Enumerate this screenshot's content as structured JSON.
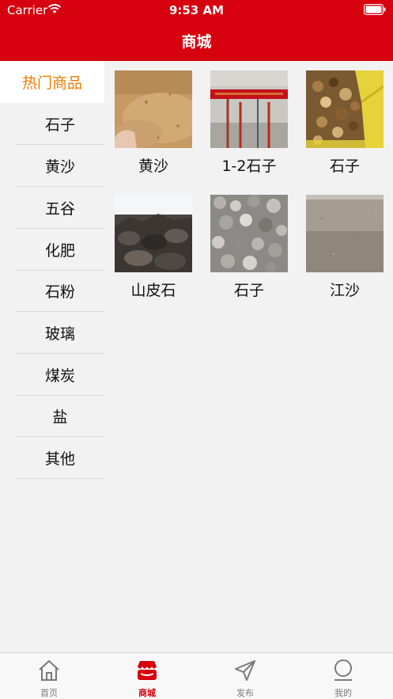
{
  "status_bar": {
    "carrier": "Carrier",
    "time": "9:53 AM"
  },
  "nav": {
    "title": "商城"
  },
  "categories": [
    {
      "label": "热门商品",
      "active": true
    },
    {
      "label": "石子"
    },
    {
      "label": "黄沙"
    },
    {
      "label": "五谷"
    },
    {
      "label": "化肥"
    },
    {
      "label": "石粉"
    },
    {
      "label": "玻璃"
    },
    {
      "label": "煤炭"
    },
    {
      "label": "盐"
    },
    {
      "label": "其他"
    }
  ],
  "products": [
    {
      "name": "黄沙",
      "image": "sand-pile-photo"
    },
    {
      "name": "1-2石子",
      "image": "wall-pipes-photo"
    },
    {
      "name": "石子",
      "image": "gravel-bag-photo"
    },
    {
      "name": "山皮石",
      "image": "rock-pile-photo"
    },
    {
      "name": "石子",
      "image": "crushed-stone-photo"
    },
    {
      "name": "江沙",
      "image": "river-sand-photo"
    }
  ],
  "tabs": [
    {
      "label": "首页",
      "icon": "home-icon"
    },
    {
      "label": "商城",
      "icon": "shop-icon",
      "active": true
    },
    {
      "label": "发布",
      "icon": "send-icon"
    },
    {
      "label": "我的",
      "icon": "user-icon"
    }
  ],
  "colors": {
    "brand_red": "#d6000f",
    "active_orange": "#f27b00",
    "background": "#f2f2f2"
  }
}
